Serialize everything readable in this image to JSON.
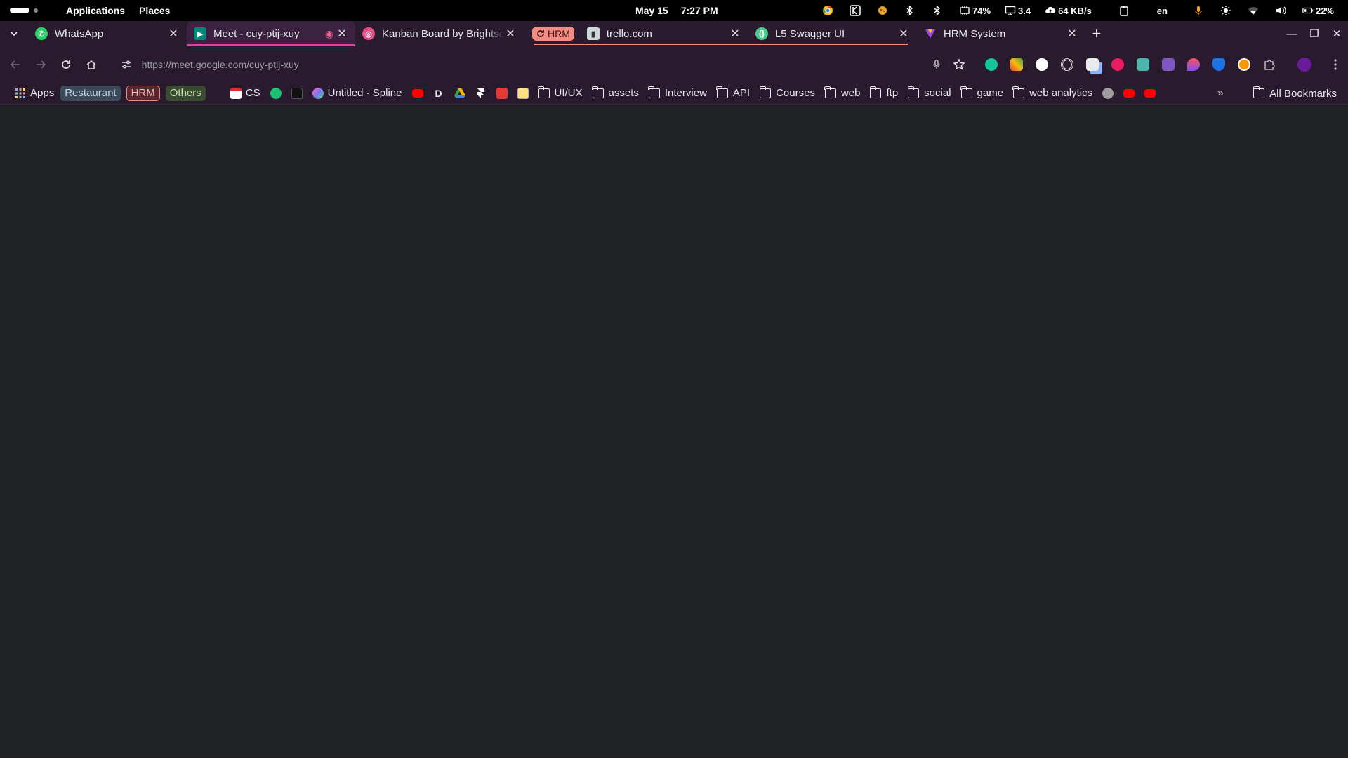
{
  "topbar": {
    "menu": [
      "Applications",
      "Places"
    ],
    "date": "May 15",
    "time": "7:27 PM",
    "tray": {
      "cpu": "74%",
      "load": "3.4",
      "net": "64 KB/s",
      "lang": "en",
      "battery": "22%"
    }
  },
  "tabs": [
    {
      "title": "WhatsApp",
      "favicon": "whatsapp-icon",
      "color": "#25d366",
      "active": false
    },
    {
      "title": "Meet - cuy-ptij-xuy",
      "favicon": "google-meet-icon",
      "color": "#00897b",
      "active": true
    },
    {
      "title": "Kanban Board by Brightsc",
      "favicon": "dribbble-icon",
      "color": "#ea4c89",
      "active": false
    },
    {
      "title": "trello.com",
      "favicon": "trello-icon",
      "color": "#0079bf",
      "active": false
    },
    {
      "title": "L5 Swagger UI",
      "favicon": "swagger-icon",
      "color": "#49cc90",
      "active": false
    },
    {
      "title": "HRM System",
      "favicon": "hrm-icon",
      "color": "#a142f4",
      "active": false
    }
  ],
  "tab_group": {
    "label": "HRM",
    "color": "#f28b82"
  },
  "toolbar": {
    "url_host": "https://meet.google.com",
    "url_path": "/cuy-ptij-xuy"
  },
  "bookmarks": {
    "apps": "Apps",
    "groups": [
      {
        "label": "Restaurant",
        "color": "blue"
      },
      {
        "label": "HRM",
        "color": "red"
      },
      {
        "label": "Others",
        "color": "green"
      }
    ],
    "cs": "CS",
    "spline": "Untitled · Spline",
    "folders": [
      "UI/UX",
      "assets",
      "Interview",
      "API",
      "Courses",
      "web",
      "ftp",
      "social",
      "game",
      "web analytics"
    ],
    "all": "All Bookmarks"
  }
}
